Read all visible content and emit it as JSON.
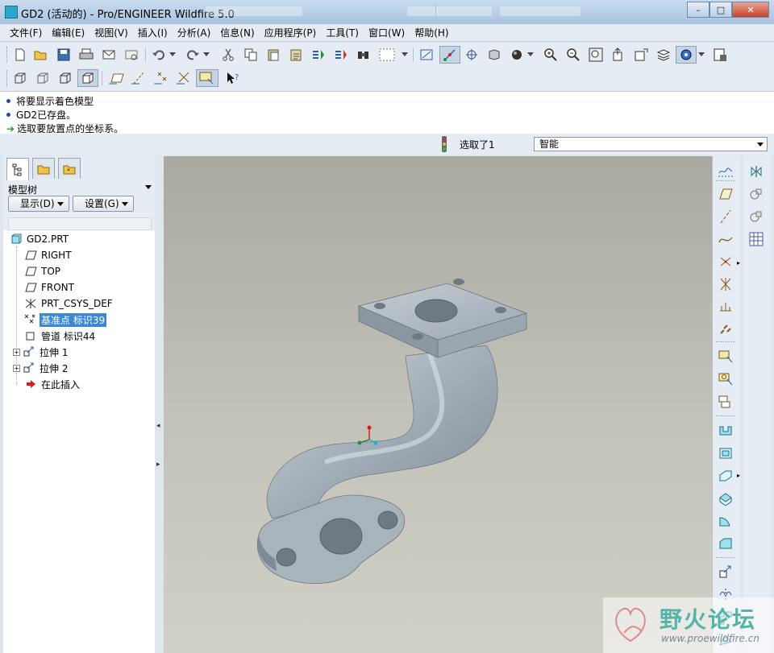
{
  "window": {
    "title": "GD2 (活动的) - Pro/ENGINEER Wildfire 5.0",
    "controls": [
      "–",
      "□",
      "✕"
    ]
  },
  "menu": [
    "文件(F)",
    "编辑(E)",
    "视图(V)",
    "插入(I)",
    "分析(A)",
    "信息(N)",
    "应用程序(P)",
    "工具(T)",
    "窗口(W)",
    "帮助(H)"
  ],
  "toolbar": {
    "row1": [
      "new-file-icon",
      "open-file-icon",
      "save-icon",
      "print-icon",
      "send-mail-icon",
      "mail-attach-icon",
      "undo-icon",
      "redo-icon",
      "cut-icon",
      "copy-icon",
      "paste-icon",
      "paste-special-icon",
      "regenerate-icon",
      "regenerate-manager-icon",
      "find-icon",
      "select-box-icon",
      "datum-display-icon",
      "spin-center-icon",
      "orient-icon",
      "saved-views-icon",
      "appearance-icon",
      "zoom-in-icon",
      "zoom-out-icon",
      "refit-icon",
      "reorient-icon",
      "view-manager-icon",
      "layers-icon",
      "spin-center-toggle-icon",
      "save-view-icon"
    ],
    "row2": [
      "wireframe-icon",
      "hidden-line-icon",
      "no-hidden-icon",
      "shaded-icon",
      "datum-planes-icon",
      "datum-axes-icon",
      "datum-points-icon",
      "coordinate-systems-icon",
      "annotation-icon",
      "context-help-icon"
    ]
  },
  "messages": [
    {
      "type": "info",
      "text": "将要显示着色模型"
    },
    {
      "type": "info",
      "text": "GD2已存盘。"
    },
    {
      "type": "prompt",
      "text": "选取要放置点的坐标系。"
    }
  ],
  "status": {
    "selected": "选取了1",
    "filter": "智能"
  },
  "navigator": {
    "tabs": [
      "model-tree-tab-icon",
      "folder-browser-tab-icon",
      "favorites-tab-icon"
    ],
    "title": "模型树",
    "show_button": "显示(D)",
    "settings_button": "设置(G)"
  },
  "tree": [
    {
      "label": "GD2.PRT",
      "icon": "part-icon",
      "level": 0
    },
    {
      "label": "RIGHT",
      "icon": "datum-plane-icon",
      "level": 1
    },
    {
      "label": "TOP",
      "icon": "datum-plane-icon",
      "level": 1
    },
    {
      "label": "FRONT",
      "icon": "datum-plane-icon",
      "level": 1
    },
    {
      "label": "PRT_CSYS_DEF",
      "icon": "coordinate-system-icon",
      "level": 1
    },
    {
      "label": "基准点 标识39",
      "icon": "datum-point-icon",
      "level": 1,
      "selected": true
    },
    {
      "label": "管道 标识44",
      "icon": "pipe-icon",
      "level": 1
    },
    {
      "label": "拉伸 1",
      "icon": "extrude-icon",
      "level": 1,
      "expandable": true
    },
    {
      "label": "拉伸 2",
      "icon": "extrude-icon",
      "level": 1,
      "expandable": true
    },
    {
      "label": "在此插入",
      "icon": "insert-here-icon",
      "level": 1
    }
  ],
  "watermark": {
    "title": "野火论坛",
    "url": "www.proewildfire.cn"
  },
  "colors": {
    "selection": "#3b88d6",
    "part_surface": "#a7b1bb",
    "background_top": "#a9a9a1",
    "background_bottom": "#d1d0c7"
  }
}
